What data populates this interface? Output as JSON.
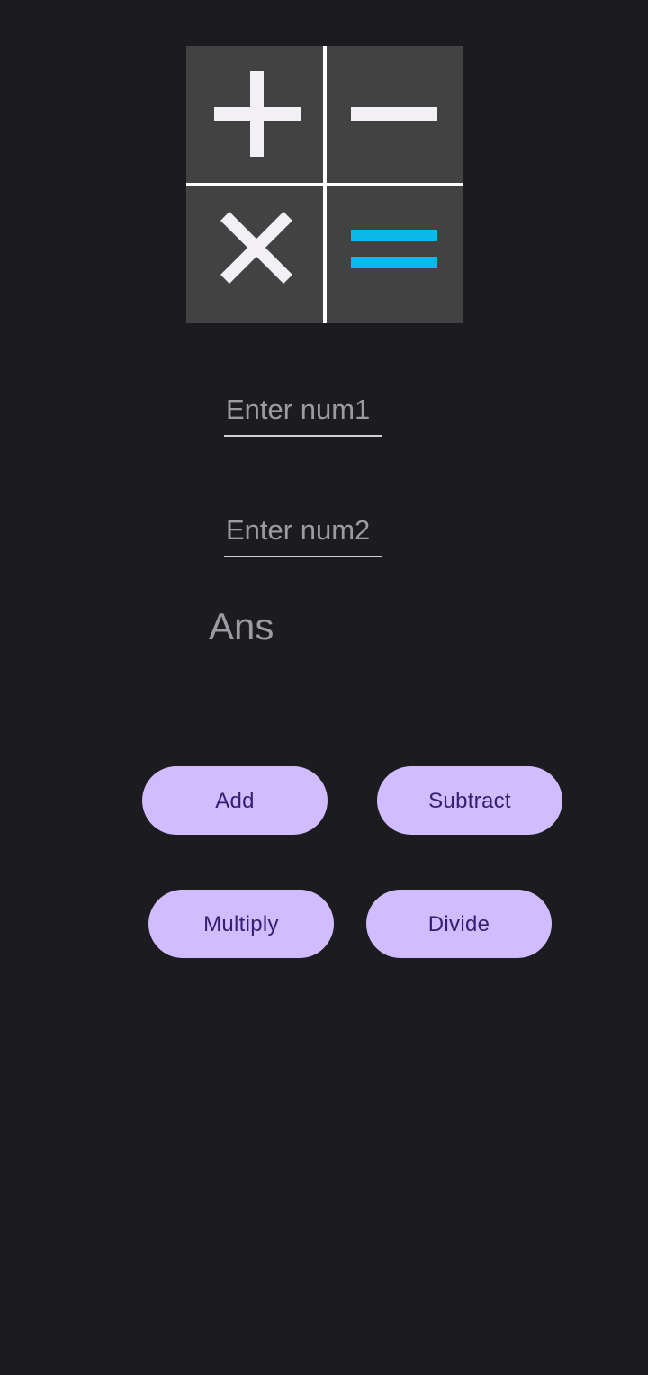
{
  "logo": {
    "icons": [
      "plus-icon",
      "minus-icon",
      "multiply-icon",
      "equals-icon"
    ],
    "colors": {
      "tile": "#424242",
      "divider": "#ffffff",
      "glyph": "#f2f0f5",
      "equals": "#0ab8ec"
    }
  },
  "inputs": {
    "num1_placeholder": "Enter num1",
    "num2_placeholder": "Enter num2"
  },
  "result": {
    "label": "Ans"
  },
  "buttons": {
    "add": "Add",
    "subtract": "Subtract",
    "multiply": "Multiply",
    "divide": "Divide"
  },
  "colors": {
    "background": "#1c1b20",
    "button": "#d0bcff",
    "button_text": "#381e72",
    "hint_text": "#9d9aa1"
  }
}
